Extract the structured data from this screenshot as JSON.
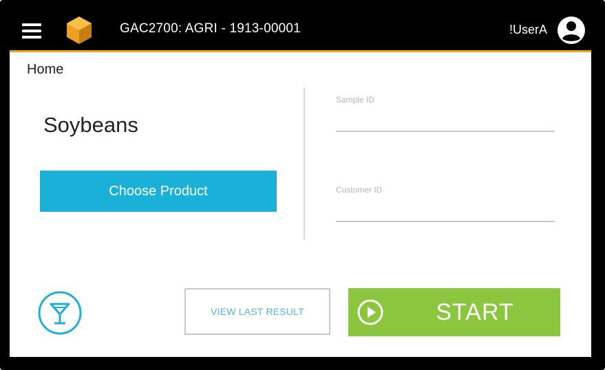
{
  "header": {
    "title": "GAC2700: AGRI - 1913-00001",
    "username": "!UserA",
    "menu_icon": "hamburger-menu-icon",
    "logo_icon": "orange-cube-logo",
    "user_icon": "user-account-icon"
  },
  "breadcrumb": "Home",
  "product": {
    "name": "Soybeans",
    "choose_label": "Choose Product"
  },
  "fields": {
    "sample_id_label": "Sample ID",
    "sample_id_value": "",
    "customer_id_label": "Customer ID",
    "customer_id_value": ""
  },
  "actions": {
    "filter_icon": "cocktail-glass-icon",
    "view_last_label": "VIEW LAST RESULT",
    "start_label": "START",
    "start_icon": "play-circle-icon"
  },
  "colors": {
    "accent_bar": "#f2a900",
    "choose_button": "#1ab0d8",
    "start_button": "#8cc63f",
    "secondary_text": "#4fb8d8"
  }
}
